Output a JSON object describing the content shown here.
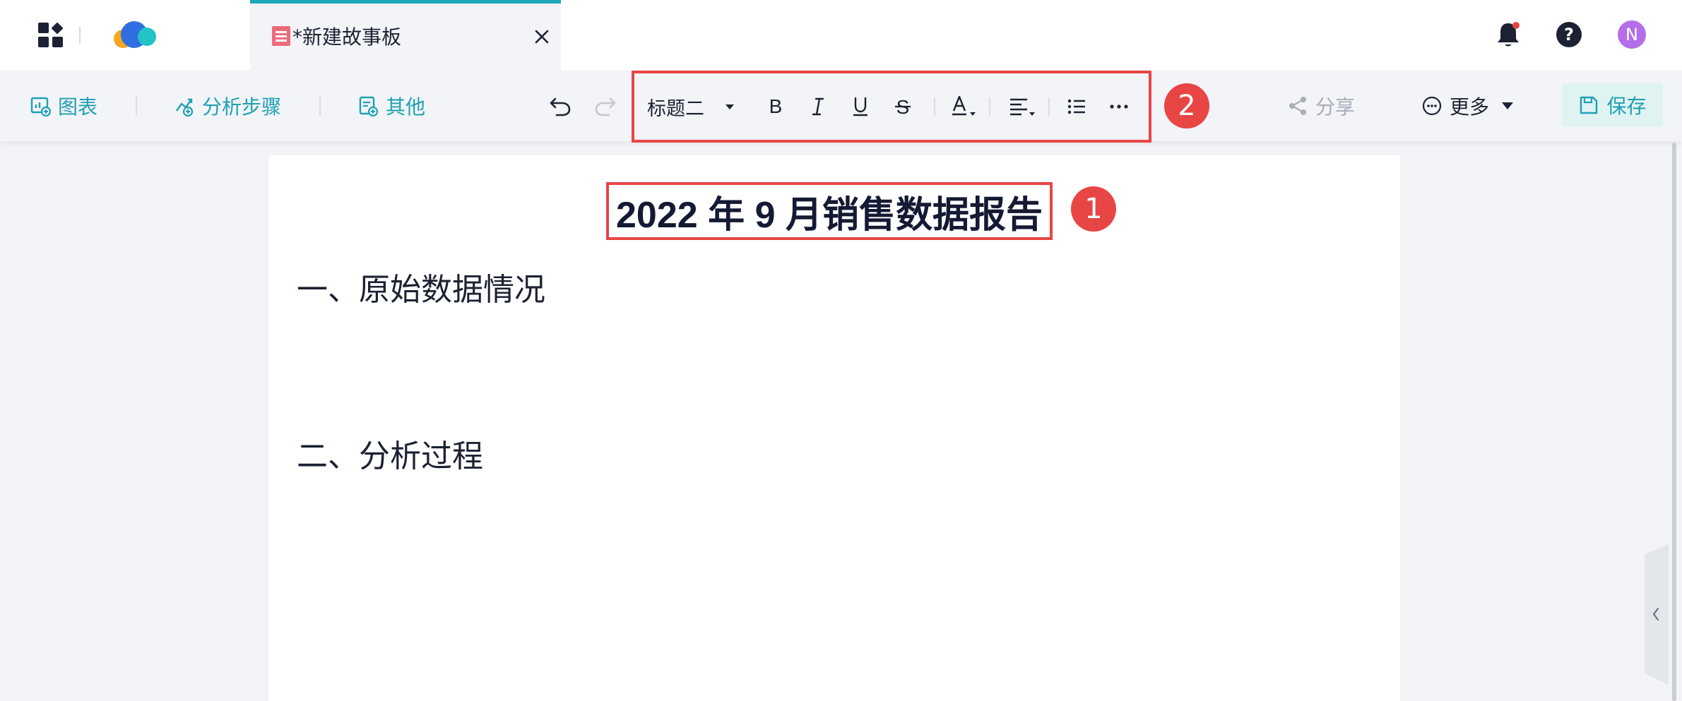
{
  "tab": {
    "title": "*新建故事板"
  },
  "user": {
    "avatar_letter": "N"
  },
  "toolbar": {
    "chart_label": "图表",
    "analysis_steps_label": "分析步骤",
    "other_label": "其他",
    "heading_style": "标题二",
    "share_label": "分享",
    "more_label": "更多",
    "save_label": "保存"
  },
  "callouts": {
    "one": "1",
    "two": "2"
  },
  "document": {
    "title": "2022 年 9 月销售数据报告",
    "section1": "一、原始数据情况",
    "section2": "二、分析过程"
  },
  "colors": {
    "accent": "#1fa0b4",
    "highlight": "#e84545",
    "avatar": "#b36ee8",
    "text": "#1c2233"
  }
}
